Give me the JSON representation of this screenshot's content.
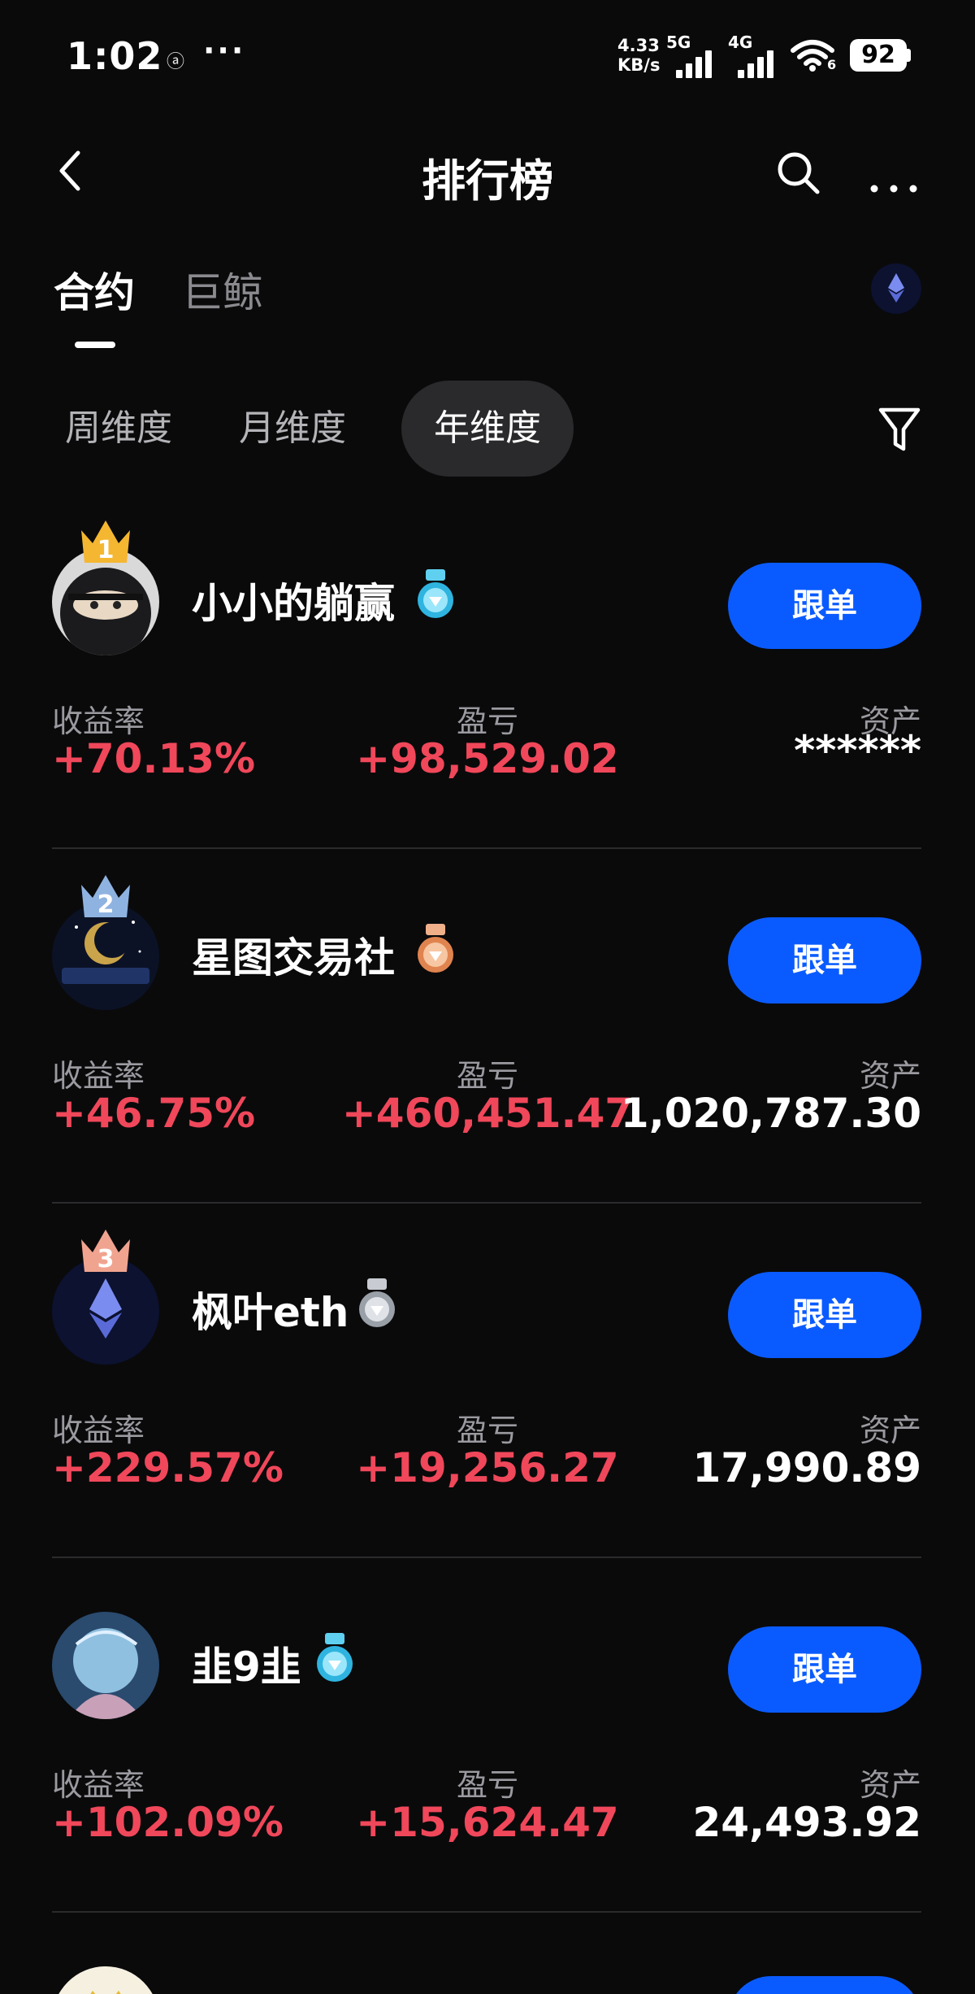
{
  "status_bar": {
    "time": "1:02",
    "notif_glyph": "ⓐ",
    "more": "···",
    "net_speed_value": "4.33",
    "net_speed_unit": "KB/s",
    "sim1_label": "5G",
    "sim2_label": "4G",
    "wifi_label": "6",
    "battery": "92"
  },
  "header": {
    "title": "排行榜",
    "icons": [
      "back-icon",
      "search-icon",
      "more-icon"
    ]
  },
  "tabs": [
    {
      "label": "合约",
      "active": true
    },
    {
      "label": "巨鲸",
      "active": false
    }
  ],
  "periods": [
    {
      "label": "周维度",
      "active": false
    },
    {
      "label": "月维度",
      "active": false
    },
    {
      "label": "年维度",
      "active": true
    }
  ],
  "labels": {
    "yield": "收益率",
    "pnl": "盈亏",
    "assets": "资产",
    "follow": "跟单"
  },
  "traders": [
    {
      "rank": "1",
      "name": "小小的躺赢",
      "yield": "+70.13%",
      "pnl": "+98,529.02",
      "assets": "******",
      "medal": "diamond-blue"
    },
    {
      "rank": "2",
      "name": "星图交易社",
      "yield": "+46.75%",
      "pnl": "+460,451.47",
      "assets": "1,020,787.30",
      "medal": "bronze"
    },
    {
      "rank": "3",
      "name": "枫叶eth",
      "yield": "+229.57%",
      "pnl": "+19,256.27",
      "assets": "17,990.89",
      "medal": "silver"
    },
    {
      "rank": "",
      "name": "韭9韭",
      "yield": "+102.09%",
      "pnl": "+15,624.47",
      "assets": "24,493.92",
      "medal": "diamond-blue"
    }
  ],
  "colors": {
    "background": "#0a0a0b",
    "accent_blue": "#0a5bff",
    "profit_red": "#f0475a",
    "muted_text": "#9a9aa0",
    "crown_gold": "#f5b731",
    "crown_silver": "#8fb3e0",
    "crown_bronze": "#f0a48f"
  }
}
